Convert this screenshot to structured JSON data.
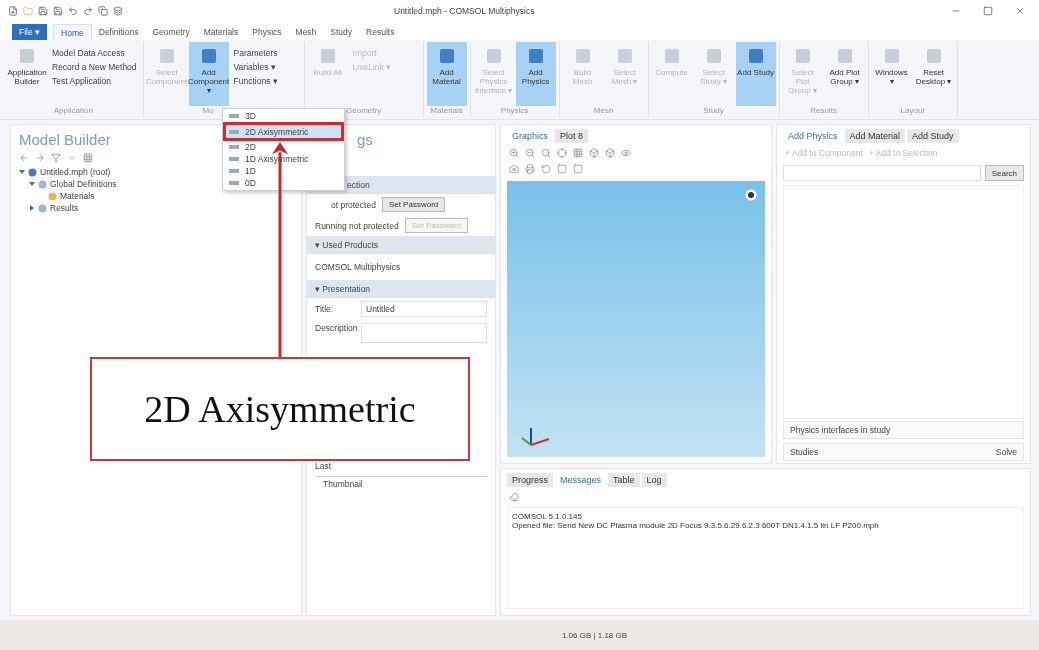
{
  "window": {
    "title": "Untitled.mph - COMSOL Multiphysics"
  },
  "ribbon_tabs": [
    {
      "label": "File ▾",
      "kind": "file",
      "selected": false
    },
    {
      "label": "Home",
      "kind": "tab",
      "selected": true
    },
    {
      "label": "Definitions",
      "kind": "tab",
      "selected": false
    },
    {
      "label": "Geometry",
      "kind": "tab",
      "selected": false
    },
    {
      "label": "Materials",
      "kind": "tab",
      "selected": false
    },
    {
      "label": "Physics",
      "kind": "tab",
      "selected": false
    },
    {
      "label": "Mesh",
      "kind": "tab",
      "selected": false
    },
    {
      "label": "Study",
      "kind": "tab",
      "selected": false
    },
    {
      "label": "Results",
      "kind": "tab",
      "selected": false
    }
  ],
  "ribbon_groups": [
    {
      "label": "Application",
      "items": [
        {
          "kind": "large",
          "label": "Application Builder",
          "selected": false,
          "disabled": false
        },
        {
          "kind": "list",
          "entries": [
            {
              "label": "Model Data Access",
              "disabled": false
            },
            {
              "label": "Record a New Method",
              "disabled": false
            },
            {
              "label": "Test Application",
              "disabled": false
            }
          ]
        }
      ]
    },
    {
      "label": "Mo",
      "items": [
        {
          "kind": "large",
          "label": "Select Component",
          "selected": false,
          "disabled": true
        },
        {
          "kind": "large",
          "label": "Add Component ▾",
          "selected": true,
          "disabled": false
        },
        {
          "kind": "list",
          "entries": [
            {
              "label": "Parameters",
              "disabled": false
            },
            {
              "label": "Variables ▾",
              "disabled": false
            },
            {
              "label": "Functions ▾",
              "disabled": false
            }
          ]
        }
      ]
    },
    {
      "label": "Geometry",
      "items": [
        {
          "kind": "large",
          "label": "Build All",
          "selected": false,
          "disabled": true
        },
        {
          "kind": "list",
          "entries": [
            {
              "label": "Import",
              "disabled": true
            },
            {
              "label": "LiveLink ▾",
              "disabled": true
            }
          ]
        }
      ]
    },
    {
      "label": "Materials",
      "items": [
        {
          "kind": "large",
          "label": "Add Material",
          "selected": true,
          "disabled": false
        }
      ]
    },
    {
      "label": "Physics",
      "items": [
        {
          "kind": "large",
          "label": "Select Physics Interface ▾",
          "selected": false,
          "disabled": true
        },
        {
          "kind": "large",
          "label": "Add Physics",
          "selected": true,
          "disabled": false
        }
      ]
    },
    {
      "label": "Mesh",
      "items": [
        {
          "kind": "large",
          "label": "Build Mesh",
          "selected": false,
          "disabled": true
        },
        {
          "kind": "large",
          "label": "Select Mesh ▾",
          "selected": false,
          "disabled": true
        }
      ]
    },
    {
      "label": "Study",
      "items": [
        {
          "kind": "large",
          "label": "Compute",
          "selected": false,
          "disabled": true
        },
        {
          "kind": "large",
          "label": "Select Study ▾",
          "selected": false,
          "disabled": true
        },
        {
          "kind": "large",
          "label": "Add Study",
          "selected": true,
          "disabled": false
        }
      ]
    },
    {
      "label": "Results",
      "items": [
        {
          "kind": "large",
          "label": "Select Plot Group ▾",
          "selected": false,
          "disabled": true
        },
        {
          "kind": "large",
          "label": "Add Plot Group ▾",
          "selected": false,
          "disabled": false
        }
      ]
    },
    {
      "label": "Layout",
      "items": [
        {
          "kind": "large",
          "label": "Windows ▾",
          "selected": false,
          "disabled": false
        },
        {
          "kind": "large",
          "label": "Reset Desktop ▾",
          "selected": false,
          "disabled": false
        }
      ]
    }
  ],
  "component_menu": {
    "items": [
      {
        "label": "3D",
        "selected": false
      },
      {
        "label": "2D Axisymmetric",
        "selected": true
      },
      {
        "label": "2D",
        "selected": false
      },
      {
        "label": "1D Axisymmetric",
        "selected": false
      },
      {
        "label": "1D",
        "selected": false
      },
      {
        "label": "0D",
        "selected": false
      }
    ]
  },
  "model_builder": {
    "title": "Model Builder",
    "tree": [
      {
        "label": "Untitled.mph (root)",
        "expanded": true,
        "children": [
          {
            "label": "Global Definitions",
            "expanded": true,
            "children": [
              {
                "label": "Materials"
              }
            ]
          },
          {
            "label": "Results",
            "expanded": false
          }
        ]
      }
    ]
  },
  "settings": {
    "title": "gs",
    "protection": {
      "title": "ection",
      "rows": [
        {
          "label": "ot protected",
          "button": "Set Password",
          "disabled": false
        },
        {
          "label": "Running not protected",
          "button": "Set Password",
          "disabled": true
        }
      ]
    },
    "used_products": {
      "title": "▾ Used Products",
      "text": "COMSOL Multiphysics"
    },
    "presentation": {
      "title": "▾ Presentation",
      "title_label": "Title:",
      "title_value": "Untitled",
      "description_label": "Description"
    },
    "last_label": "Last",
    "thumbnail_label": "Thumbnail"
  },
  "graphics": {
    "tabs": [
      {
        "label": "Graphics",
        "selected": true
      },
      {
        "label": "Plot 8",
        "selected": false
      }
    ]
  },
  "add_panel": {
    "tabs": [
      {
        "label": "Add Physics",
        "selected": true
      },
      {
        "label": "Add Material",
        "selected": false
      },
      {
        "label": "Add Study",
        "selected": false
      }
    ],
    "actions": [
      "+ Add to Component",
      "+ Add to Selection"
    ],
    "search_button": "Search",
    "interfaces_label": "Physics interfaces in study",
    "studies_label": "Studies",
    "solve_label": "Solve"
  },
  "messages": {
    "tabs": [
      {
        "label": "Progress",
        "selected": false
      },
      {
        "label": "Messages",
        "selected": true
      },
      {
        "label": "Table",
        "selected": false
      },
      {
        "label": "Log",
        "selected": false
      }
    ],
    "lines": [
      "COMSOL 5.1.0.145",
      "Opened file: Send New DC Plasma module 2D Focus 9.3.5.6.29.6.2.3 600T DN1.4.1.5 lin LF P200.mph"
    ]
  },
  "status_bar": {
    "memory": "1.06 GB | 1.18 GB"
  },
  "callout": {
    "text": "2D Axisymmetric"
  }
}
